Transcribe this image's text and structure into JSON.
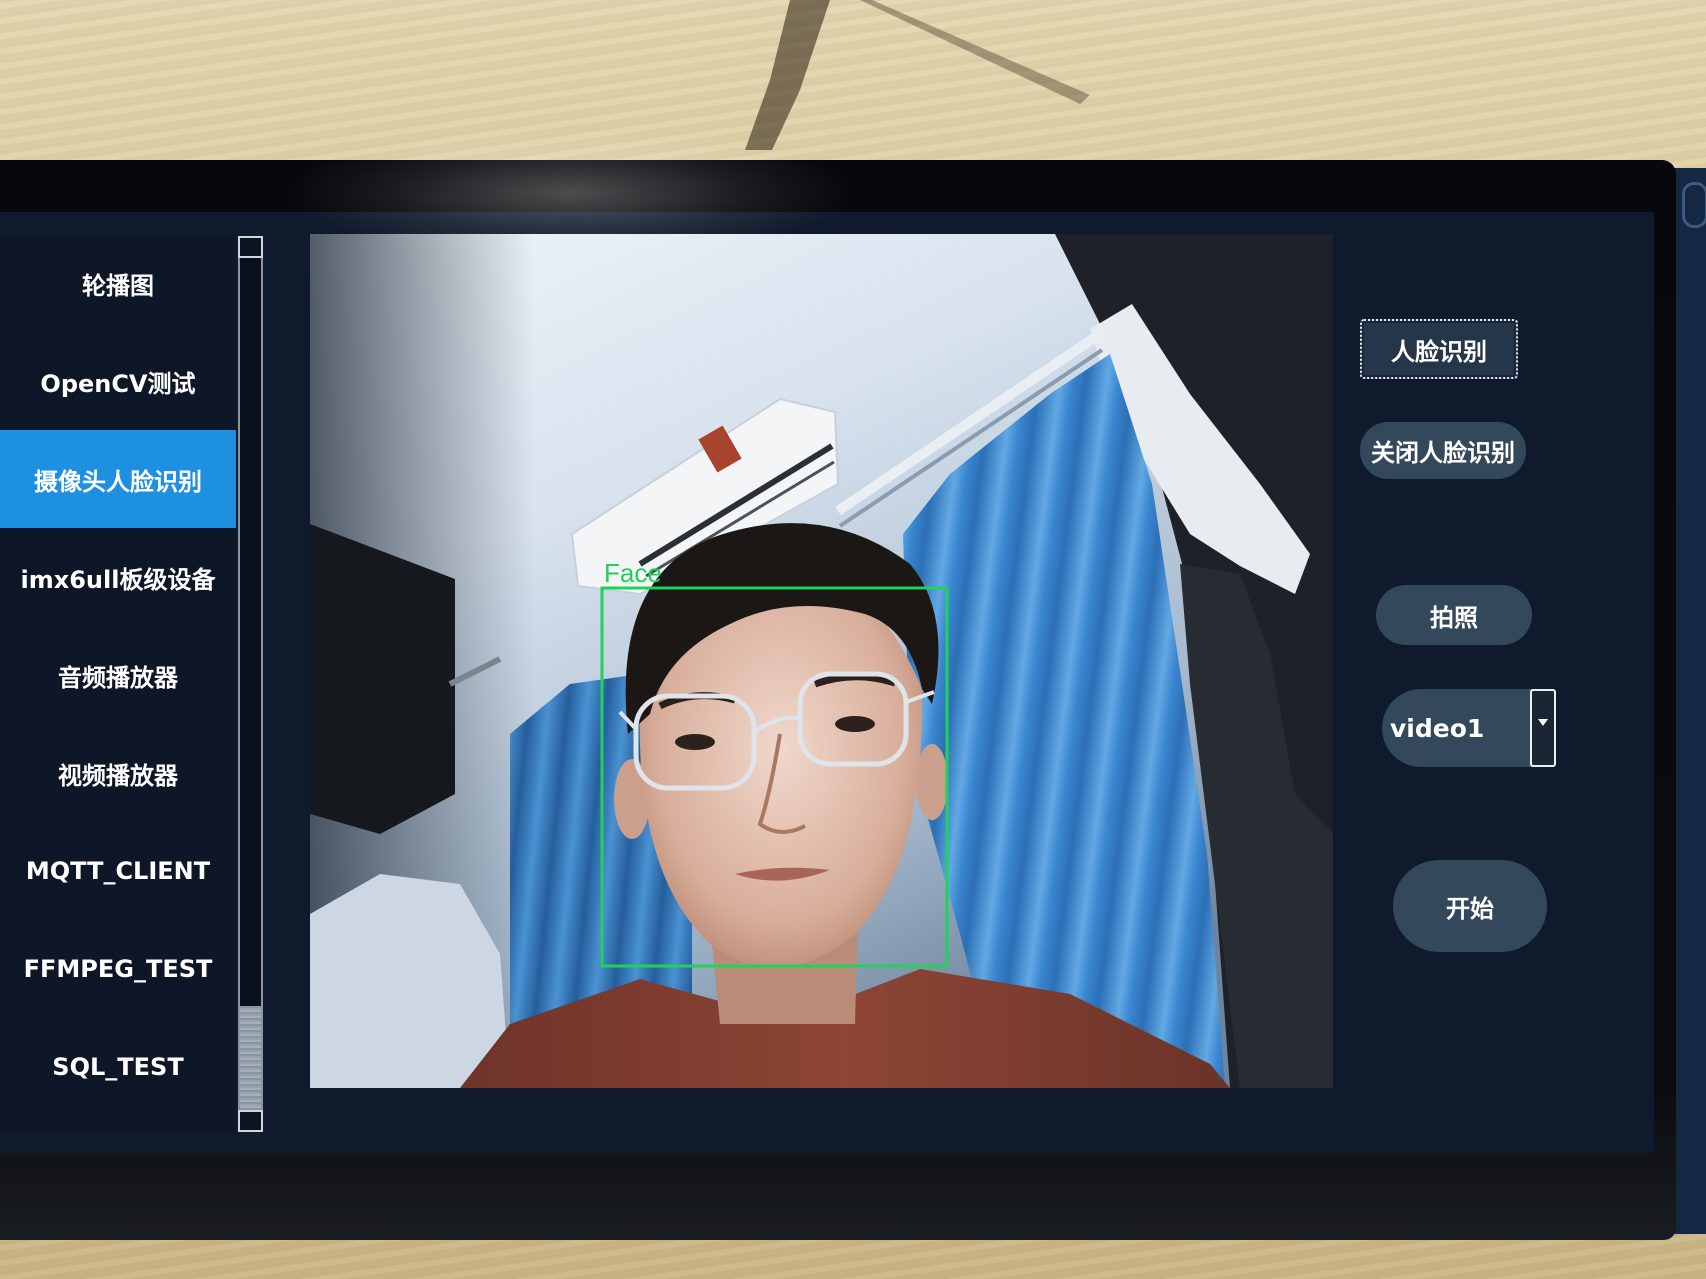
{
  "sidebar": {
    "items": [
      "轮播图",
      "OpenCV测试",
      "摄像头人脸识别",
      "imx6ull板级设备",
      "音频播放器",
      "视频播放器",
      "MQTT_CLIENT",
      "FFMPEG_TEST",
      "SQL_TEST"
    ],
    "selected_index": 2,
    "scroll_position": 1.0
  },
  "camera": {
    "detection_label": "Face"
  },
  "controls": {
    "face_detect_button": "人脸识别",
    "close_face_detect_button": "关闭人脸识别",
    "capture_button": "拍照",
    "device_select": {
      "value": "video1",
      "icon": "chevron-down-icon"
    },
    "start_button": "开始"
  },
  "colors": {
    "screen_bg": "#0f1a2c",
    "selected_item_bg": "#1e90e2",
    "button_bg": "#34485b",
    "detection_box": "#22d05a",
    "text": "#ffffff"
  }
}
